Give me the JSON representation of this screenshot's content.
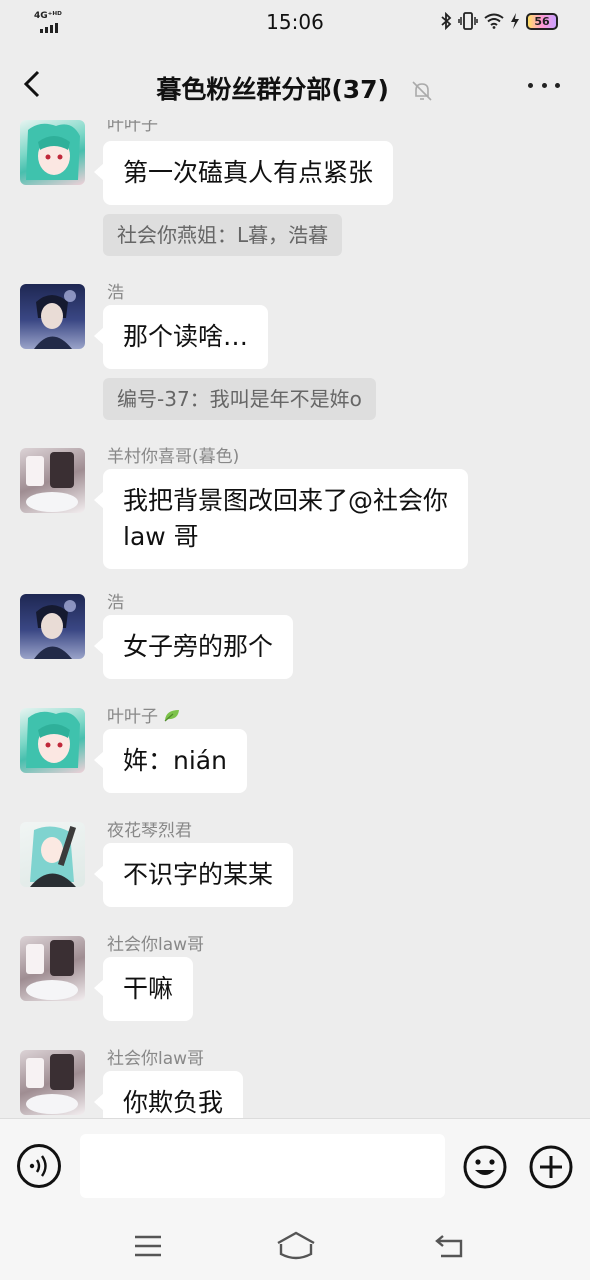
{
  "status_bar": {
    "network": "4G⁺ᴴᴰ",
    "time": "15:06",
    "battery": "56"
  },
  "header": {
    "title": "暮色粉丝群分部(37)"
  },
  "messages": [
    {
      "sender": "叶叶子",
      "text": "第一次磕真人有点紧张",
      "quote": "社会你燕姐：L暮，浩暮",
      "avatar": "green-hair-anime-avatar"
    },
    {
      "sender": "浩",
      "text": "那个读啥…",
      "quote": "编号-37：我叫是年不是姩o",
      "avatar": "dark-anime-boy-avatar"
    },
    {
      "sender": "羊村你喜哥(暮色)",
      "text_line1": "我把背景图改回来了@社会你",
      "text_line2": "law 哥",
      "avatar": "plush-photo-avatar"
    },
    {
      "sender": "浩",
      "text": "女子旁的那个",
      "avatar": "dark-anime-boy-avatar"
    },
    {
      "sender": "叶叶子",
      "text": "姩：nián",
      "avatar": "green-hair-anime-avatar"
    },
    {
      "sender": "夜花琴烈君",
      "text": "不识字的某某",
      "avatar": "teal-hair-anime-avatar"
    },
    {
      "sender": "社会你law哥",
      "text": "干嘛",
      "avatar": "plush-photo-avatar"
    },
    {
      "sender": "社会你law哥",
      "text": "你欺负我",
      "avatar": "plush-photo-avatar"
    }
  ],
  "input": {
    "placeholder": ""
  },
  "colors": {
    "background": "#ededed",
    "bubble": "#ffffff",
    "quote_bg": "#dedede",
    "sender_text": "#888888"
  }
}
